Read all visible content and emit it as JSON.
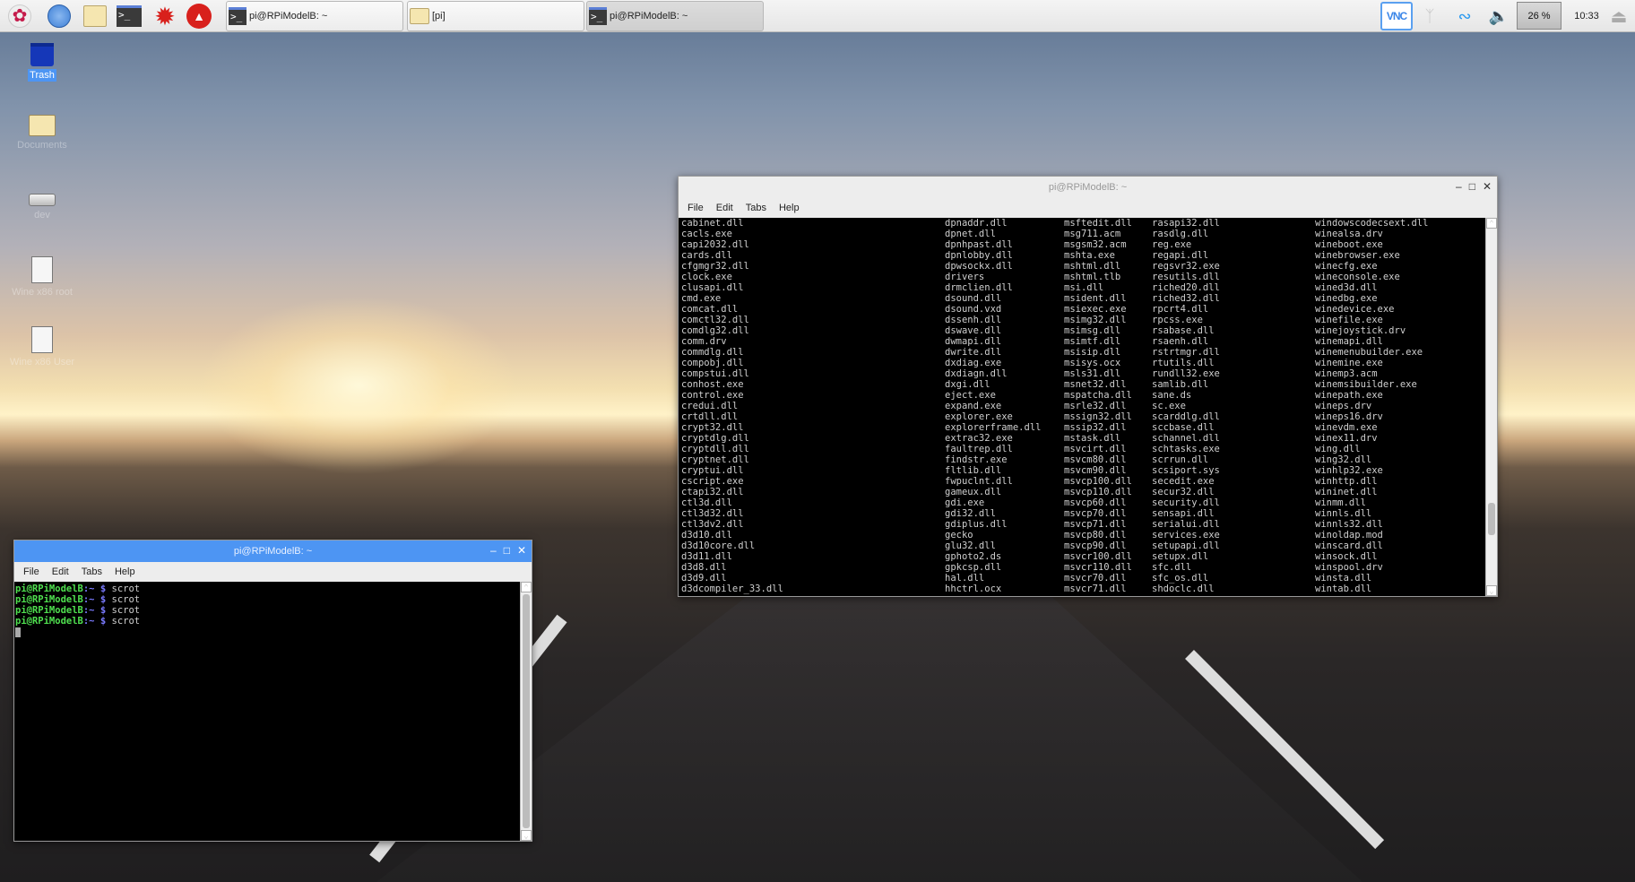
{
  "taskbar": {
    "launchers": [
      {
        "icon": "raspberry-menu-icon"
      },
      {
        "icon": "web-browser-icon"
      },
      {
        "icon": "file-manager-icon"
      },
      {
        "icon": "terminal-icon"
      },
      {
        "icon": "mathematica-icon"
      },
      {
        "icon": "wolfram-icon"
      }
    ],
    "tasks": [
      {
        "label": "pi@RPiModelB: ~",
        "icon": "terminal-icon"
      },
      {
        "label": "[pi]",
        "icon": "folder-icon"
      },
      {
        "label": "pi@RPiModelB: ~",
        "icon": "terminal-icon",
        "active": true
      }
    ],
    "tray": {
      "vnc": "VNC",
      "cpu": "26 %",
      "clock": "10:33"
    }
  },
  "desktop": {
    "icons": [
      {
        "label": "Trash",
        "icon": "trash-icon"
      },
      {
        "label": "Documents",
        "icon": "documents-folder-icon"
      },
      {
        "label": "dev",
        "icon": "drive-icon"
      },
      {
        "label": "Wine x86 root",
        "icon": "wine-shortcut-icon"
      },
      {
        "label": "Wine x86 User",
        "icon": "wine-shortcut-icon"
      }
    ]
  },
  "big_terminal": {
    "title": "pi@RPiModelB: ~",
    "menu": [
      "File",
      "Edit",
      "Tabs",
      "Help"
    ],
    "columns": [
      [
        "cabinet.dll",
        "cacls.exe",
        "capi2032.dll",
        "cards.dll",
        "cfgmgr32.dll",
        "clock.exe",
        "clusapi.dll",
        "cmd.exe",
        "comcat.dll",
        "comctl32.dll",
        "comdlg32.dll",
        "comm.drv",
        "commdlg.dll",
        "compobj.dll",
        "compstui.dll",
        "conhost.exe",
        "control.exe",
        "credui.dll",
        "crtdll.dll",
        "crypt32.dll",
        "cryptdlg.dll",
        "cryptdll.dll",
        "cryptnet.dll",
        "cryptui.dll",
        "cscript.exe",
        "ctapi32.dll",
        "ctl3d.dll",
        "ctl3d32.dll",
        "ctl3dv2.dll",
        "d3d10.dll",
        "d3d10core.dll",
        "d3d11.dll",
        "d3d8.dll",
        "d3d9.dll",
        "d3dcompiler_33.dll"
      ],
      [
        "dpnaddr.dll",
        "dpnet.dll",
        "dpnhpast.dll",
        "dpnlobby.dll",
        "dpwsockx.dll",
        "drivers",
        "drmclien.dll",
        "dsound.dll",
        "dsound.vxd",
        "dssenh.dll",
        "dswave.dll",
        "dwmapi.dll",
        "dwrite.dll",
        "dxdiag.exe",
        "dxdiagn.dll",
        "dxgi.dll",
        "eject.exe",
        "expand.exe",
        "explorer.exe",
        "explorerframe.dll",
        "extrac32.exe",
        "faultrep.dll",
        "findstr.exe",
        "fltlib.dll",
        "fwpuclnt.dll",
        "gameux.dll",
        "gdi.exe",
        "gdi32.dll",
        "gdiplus.dll",
        "gecko",
        "glu32.dll",
        "gphoto2.ds",
        "gpkcsp.dll",
        "hal.dll",
        "hhctrl.ocx"
      ],
      [
        "msftedit.dll",
        "msg711.acm",
        "msgsm32.acm",
        "mshta.exe",
        "mshtml.dll",
        "mshtml.tlb",
        "msi.dll",
        "msident.dll",
        "msiexec.exe",
        "msimg32.dll",
        "msimsg.dll",
        "msimtf.dll",
        "msisip.dll",
        "msisys.ocx",
        "msls31.dll",
        "msnet32.dll",
        "mspatcha.dll",
        "msrle32.dll",
        "mssign32.dll",
        "mssip32.dll",
        "mstask.dll",
        "msvcirt.dll",
        "msvcm80.dll",
        "msvcm90.dll",
        "msvcp100.dll",
        "msvcp110.dll",
        "msvcp60.dll",
        "msvcp70.dll",
        "msvcp71.dll",
        "msvcp80.dll",
        "msvcp90.dll",
        "msvcr100.dll",
        "msvcr110.dll",
        "msvcr70.dll",
        "msvcr71.dll"
      ],
      [
        "rasapi32.dll",
        "rasdlg.dll",
        "reg.exe",
        "regapi.dll",
        "regsvr32.exe",
        "resutils.dll",
        "riched20.dll",
        "riched32.dll",
        "rpcrt4.dll",
        "rpcss.exe",
        "rsabase.dll",
        "rsaenh.dll",
        "rstrtmgr.dll",
        "rtutils.dll",
        "rundll32.exe",
        "samlib.dll",
        "sane.ds",
        "sc.exe",
        "scarddlg.dll",
        "sccbase.dll",
        "schannel.dll",
        "schtasks.exe",
        "scrrun.dll",
        "scsiport.sys",
        "secedit.exe",
        "secur32.dll",
        "security.dll",
        "sensapi.dll",
        "serialui.dll",
        "services.exe",
        "setupapi.dll",
        "setupx.dll",
        "sfc.dll",
        "sfc_os.dll",
        "shdoclc.dll"
      ],
      [
        "windowscodecsext.dll",
        "winealsa.drv",
        "wineboot.exe",
        "winebrowser.exe",
        "winecfg.exe",
        "wineconsole.exe",
        "wined3d.dll",
        "winedbg.exe",
        "winedevice.exe",
        "winefile.exe",
        "winejoystick.drv",
        "winemapi.dll",
        "winemenubuilder.exe",
        "winemine.exe",
        "winemp3.acm",
        "winemsibuilder.exe",
        "winepath.exe",
        "wineps.drv",
        "wineps16.drv",
        "winevdm.exe",
        "winex11.drv",
        "wing.dll",
        "wing32.dll",
        "winhlp32.exe",
        "winhttp.dll",
        "wininet.dll",
        "winmm.dll",
        "winnls.dll",
        "winnls32.dll",
        "winoldap.mod",
        "winscard.dll",
        "winsock.dll",
        "winspool.drv",
        "winsta.dll",
        "wintab.dll"
      ]
    ],
    "scroll_position": 0.85
  },
  "small_terminal": {
    "title": "pi@RPiModelB: ~",
    "menu": [
      "File",
      "Edit",
      "Tabs",
      "Help"
    ],
    "lines": [
      {
        "user": "pi@RPiModelB",
        "path": ":~",
        "sym": " $",
        "cmd": " scrot"
      },
      {
        "user": "pi@RPiModelB",
        "path": ":~",
        "sym": " $",
        "cmd": " scrot"
      },
      {
        "user": "pi@RPiModelB",
        "path": ":~",
        "sym": " $",
        "cmd": " scrot"
      },
      {
        "user": "pi@RPiModelB",
        "path": ":~",
        "sym": " $",
        "cmd": " scrot"
      }
    ]
  },
  "colors": {
    "active_title": "#4d95f3",
    "prompt_user": "#4fe04f",
    "prompt_symbol": "#7a7aff"
  }
}
